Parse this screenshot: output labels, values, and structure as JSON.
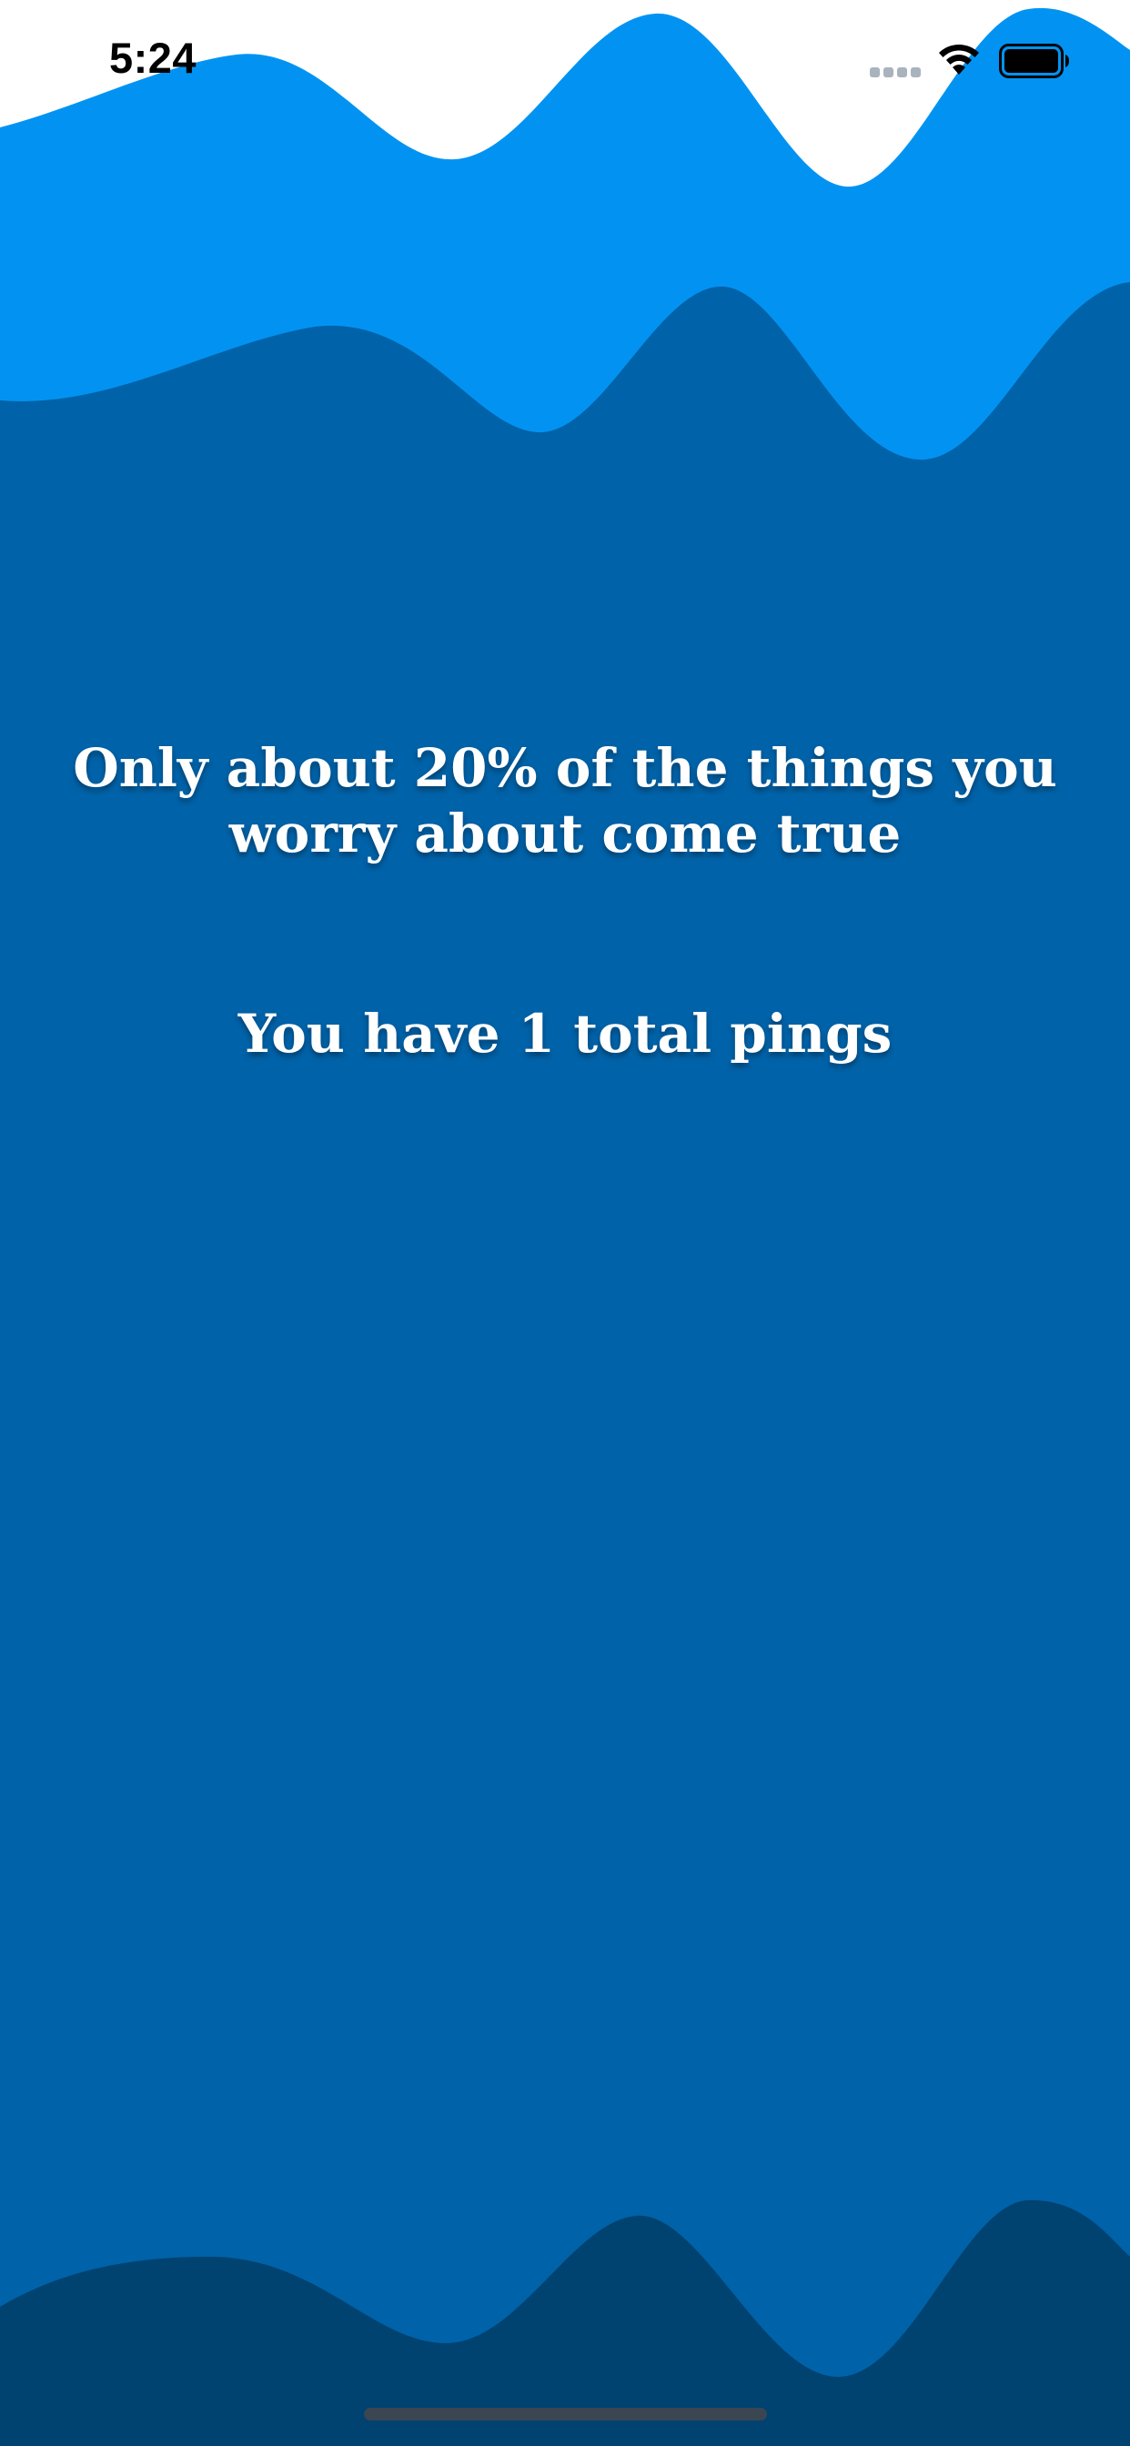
{
  "status_bar": {
    "time": "5:24"
  },
  "content": {
    "quote": "Only about 20% of the things you worry about come true",
    "pings_text": "You have 1 total pings"
  },
  "colors": {
    "top_wave_light": "#0293f2",
    "background": "#0062a8",
    "bottom_wave_dark": "#004270",
    "text": "#ffffff"
  },
  "icons": [
    "signal-icon",
    "wifi-icon",
    "battery-icon"
  ]
}
